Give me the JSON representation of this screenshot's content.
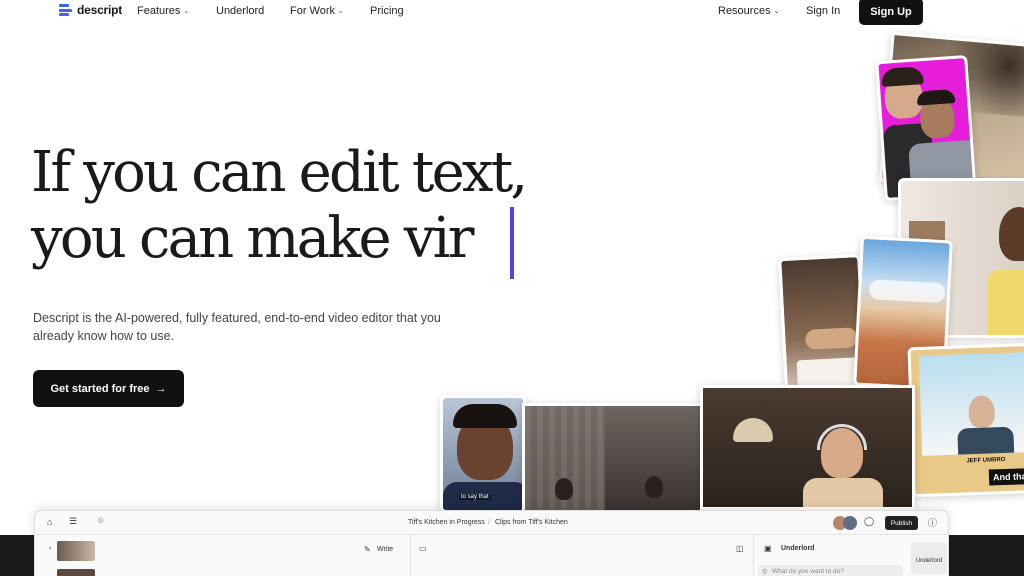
{
  "nav": {
    "logo_text": "descript",
    "features": "Features",
    "underlord": "Underlord",
    "for_work": "For Work",
    "pricing": "Pricing",
    "resources": "Resources",
    "sign_in": "Sign In",
    "sign_up": "Sign Up"
  },
  "hero": {
    "headline_line1": "If you can edit text,",
    "headline_line2": "you can make vir",
    "subtext": "Descript is the AI-powered, fully featured, end-to-end video editor that you already know how to use.",
    "cta_label": "Get started for free",
    "cta_arrow": "→"
  },
  "collage": {
    "caption_name": "JEFF UMBRO",
    "caption_text": "And tha",
    "subtitle_small": "to say that"
  },
  "app": {
    "breadcrumb_project": "Tiff's Kitchen in Progress",
    "breadcrumb_sep": "/",
    "breadcrumb_clip": "Clips from Tiff's Kitchen",
    "write_label": "Write",
    "publish_label": "Publish",
    "panel_title": "Underlord",
    "search_placeholder": "What do you want to do?",
    "underlord_button": "Underlord"
  },
  "colors": {
    "accent": "#4f46e5",
    "logo_blue": "#4361ee",
    "dark": "#111111",
    "magenta": "#e61edc"
  }
}
